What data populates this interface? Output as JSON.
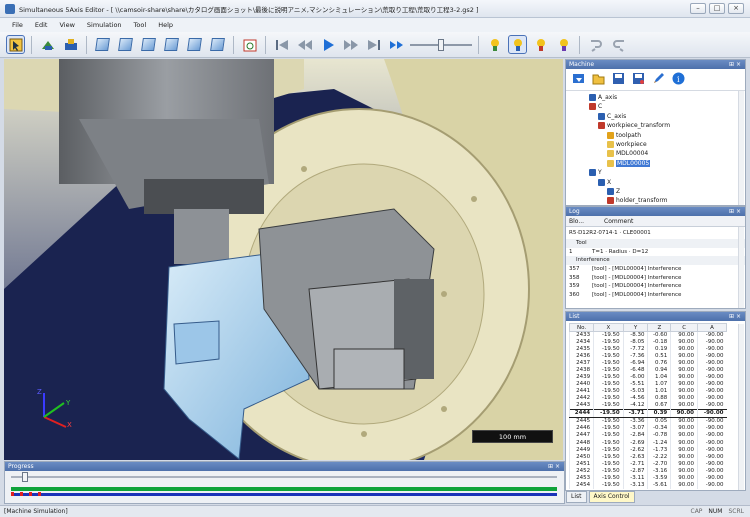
{
  "window": {
    "title": "Simultaneous 5Axis Editor - [ \\\\camsoir-share\\share\\カタログ画面ショット\\最後に説明アニメ,マシンシミュレーション\\荒取り工程\\荒取り工程3-2.gs2 ]"
  },
  "menu": [
    "File",
    "Edit",
    "View",
    "Simulation",
    "Tool",
    "Help"
  ],
  "toolbar": {
    "icons": [
      "select-icon",
      "machine-icon",
      "workpiece-icon",
      "view-iso-icon",
      "view-front-icon",
      "view-back-icon",
      "view-left-icon",
      "view-right-icon",
      "view-top-icon",
      "snapshot-icon",
      "step-first-icon",
      "step-back-icon",
      "play-icon",
      "step-forward-icon",
      "step-last-icon",
      "fast-forward-icon",
      "tool-check-icon",
      "holder-check-icon",
      "collision-check-icon",
      "gouge-check-icon",
      "undo-icon",
      "redo-icon"
    ],
    "speed_level": 0.5
  },
  "viewport": {
    "scale_label": "100 mm",
    "axes": {
      "x": "X",
      "y": "Y",
      "z": "Z"
    }
  },
  "progress": {
    "title": "Progress",
    "value": 0.02
  },
  "machine_panel": {
    "title": "Machine",
    "tree": [
      {
        "label": "A_axis",
        "indent": 1,
        "icon": "axis-icon"
      },
      {
        "label": "C",
        "indent": 1,
        "icon": "group-icon"
      },
      {
        "label": "C_axis",
        "indent": 2,
        "icon": "axis-icon"
      },
      {
        "label": "workpiece_transform",
        "indent": 2,
        "icon": "group-icon"
      },
      {
        "label": "toolpath",
        "indent": 3,
        "icon": "toolpath-icon"
      },
      {
        "label": "workpiece",
        "indent": 3,
        "icon": "solid-icon"
      },
      {
        "label": "MDL00004",
        "indent": 3,
        "icon": "solid-icon"
      },
      {
        "label": "MDL00005",
        "indent": 3,
        "icon": "solid-icon",
        "selected": true
      },
      {
        "label": "Y",
        "indent": 1,
        "icon": "axis-icon"
      },
      {
        "label": "X",
        "indent": 2,
        "icon": "axis-icon"
      },
      {
        "label": "Z",
        "indent": 3,
        "icon": "axis-icon"
      },
      {
        "label": "holder_transform",
        "indent": 3,
        "icon": "group-icon"
      }
    ]
  },
  "log_panel": {
    "title": "Log",
    "columns": [
      "Blo...",
      "Comment"
    ],
    "header_line": "R5·D12R2·0714·1 · CLE00001",
    "group_tool": "Tool",
    "tool_row": {
      "block": "1",
      "comment": "T=1 · Radius · D=12"
    },
    "group_interference": "Interference",
    "rows": [
      {
        "block": "357",
        "comment": "[tool] - [MDL00004] Interference"
      },
      {
        "block": "358",
        "comment": "[tool] - [MDL00004] Interference"
      },
      {
        "block": "359",
        "comment": "[tool] - [MDL00004] Interference"
      },
      {
        "block": "360",
        "comment": "[tool] - [MDL00004] Interference"
      }
    ]
  },
  "list_panel": {
    "title": "List",
    "columns": [
      "No.",
      "X",
      "Y",
      "Z",
      "C",
      "A"
    ],
    "rows": [
      [
        "2433",
        "-19.50",
        "-8.30",
        "-0.60",
        "90.00",
        "-90.00"
      ],
      [
        "2434",
        "-19.50",
        "-8.05",
        "-0.18",
        "90.00",
        "-90.00"
      ],
      [
        "2435",
        "-19.50",
        "-7.72",
        "0.19",
        "90.00",
        "-90.00"
      ],
      [
        "2436",
        "-19.50",
        "-7.36",
        "0.51",
        "90.00",
        "-90.00"
      ],
      [
        "2437",
        "-19.50",
        "-6.94",
        "0.76",
        "90.00",
        "-90.00"
      ],
      [
        "2438",
        "-19.50",
        "-6.48",
        "0.94",
        "90.00",
        "-90.00"
      ],
      [
        "2439",
        "-19.50",
        "-6.00",
        "1.04",
        "90.00",
        "-90.00"
      ],
      [
        "2440",
        "-19.50",
        "-5.51",
        "1.07",
        "90.00",
        "-90.00"
      ],
      [
        "2441",
        "-19.50",
        "-5.03",
        "1.01",
        "90.00",
        "-90.00"
      ],
      [
        "2442",
        "-19.50",
        "-4.56",
        "0.88",
        "90.00",
        "-90.00"
      ],
      [
        "2443",
        "-19.50",
        "-4.12",
        "0.67",
        "90.00",
        "-90.00"
      ],
      [
        "2444",
        "-19.50",
        "-3.71",
        "0.39",
        "90.00",
        "-90.00"
      ],
      [
        "2445",
        "-19.50",
        "-3.36",
        "0.05",
        "90.00",
        "-90.00"
      ],
      [
        "2446",
        "-19.50",
        "-3.07",
        "-0.34",
        "90.00",
        "-90.00"
      ],
      [
        "2447",
        "-19.50",
        "-2.84",
        "-0.78",
        "90.00",
        "-90.00"
      ],
      [
        "2448",
        "-19.50",
        "-2.69",
        "-1.24",
        "90.00",
        "-90.00"
      ],
      [
        "2449",
        "-19.50",
        "-2.62",
        "-1.73",
        "90.00",
        "-90.00"
      ],
      [
        "2450",
        "-19.50",
        "-2.63",
        "-2.22",
        "90.00",
        "-90.00"
      ],
      [
        "2451",
        "-19.50",
        "-2.71",
        "-2.70",
        "90.00",
        "-90.00"
      ],
      [
        "2452",
        "-19.50",
        "-2.87",
        "-3.16",
        "90.00",
        "-90.00"
      ],
      [
        "2453",
        "-19.50",
        "-3.11",
        "-3.59",
        "90.00",
        "-90.00"
      ],
      [
        "2454",
        "-19.50",
        "-3.13",
        "-5.61",
        "90.00",
        "-90.00"
      ]
    ],
    "current_index": 11
  },
  "bottom_tabs": [
    "List",
    "Axis Control"
  ],
  "status": {
    "left": "[Machine Simulation]",
    "cap": "CAP",
    "num": "NUM",
    "scrl": "SCRL"
  }
}
